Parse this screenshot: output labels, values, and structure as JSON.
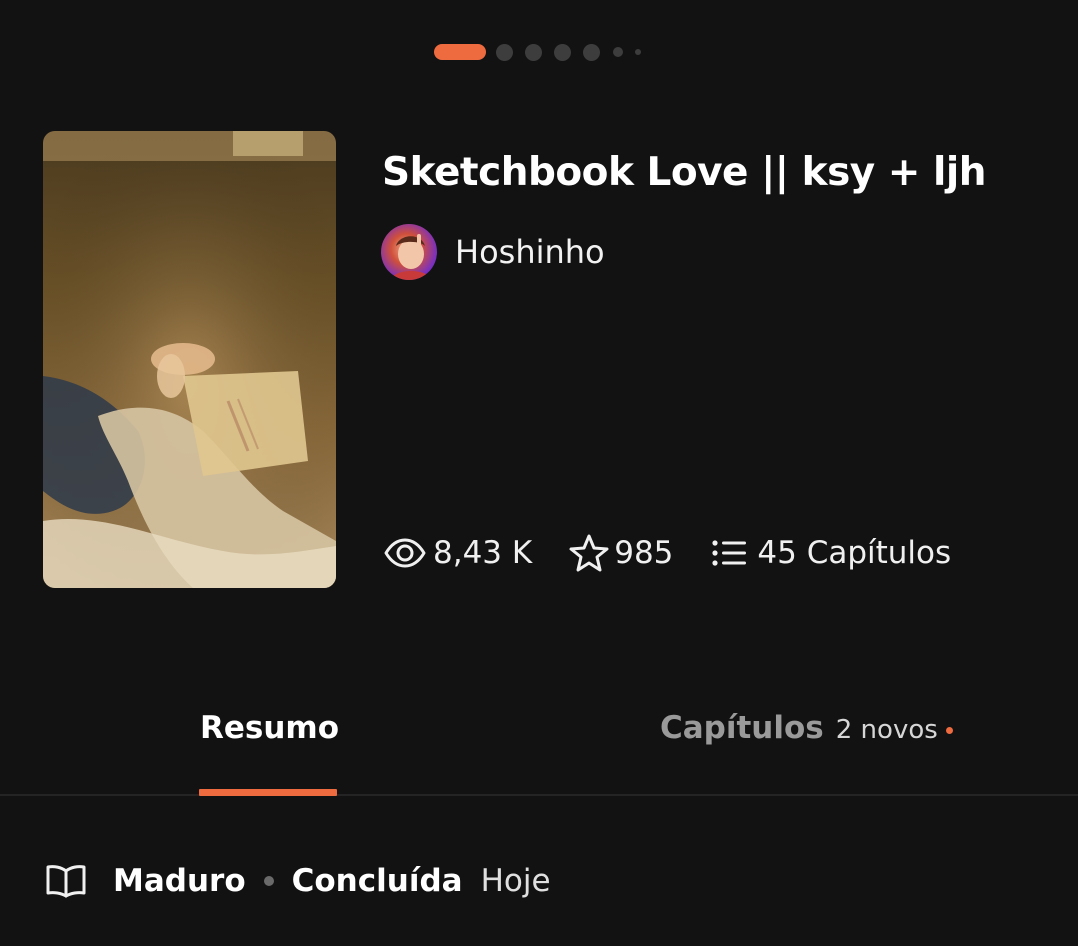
{
  "pager": {
    "active_index": 0,
    "total": 7
  },
  "story": {
    "title": "Sketchbook Love || ksy + ljh",
    "author": "Hoshinho",
    "cover_icon": "book-cover-image"
  },
  "stats": {
    "views": "8,43 K",
    "votes": "985",
    "chapters": "45 Capítulos"
  },
  "tabs": {
    "summary": "Resumo",
    "chapters": "Capítulos",
    "chapters_new": "2 novos"
  },
  "meta": {
    "rating": "Maduro",
    "status": "Concluída",
    "updated": "Hoje"
  },
  "colors": {
    "background": "#121212",
    "accent": "#ee6a3f",
    "muted_text": "#9a9a9a"
  }
}
